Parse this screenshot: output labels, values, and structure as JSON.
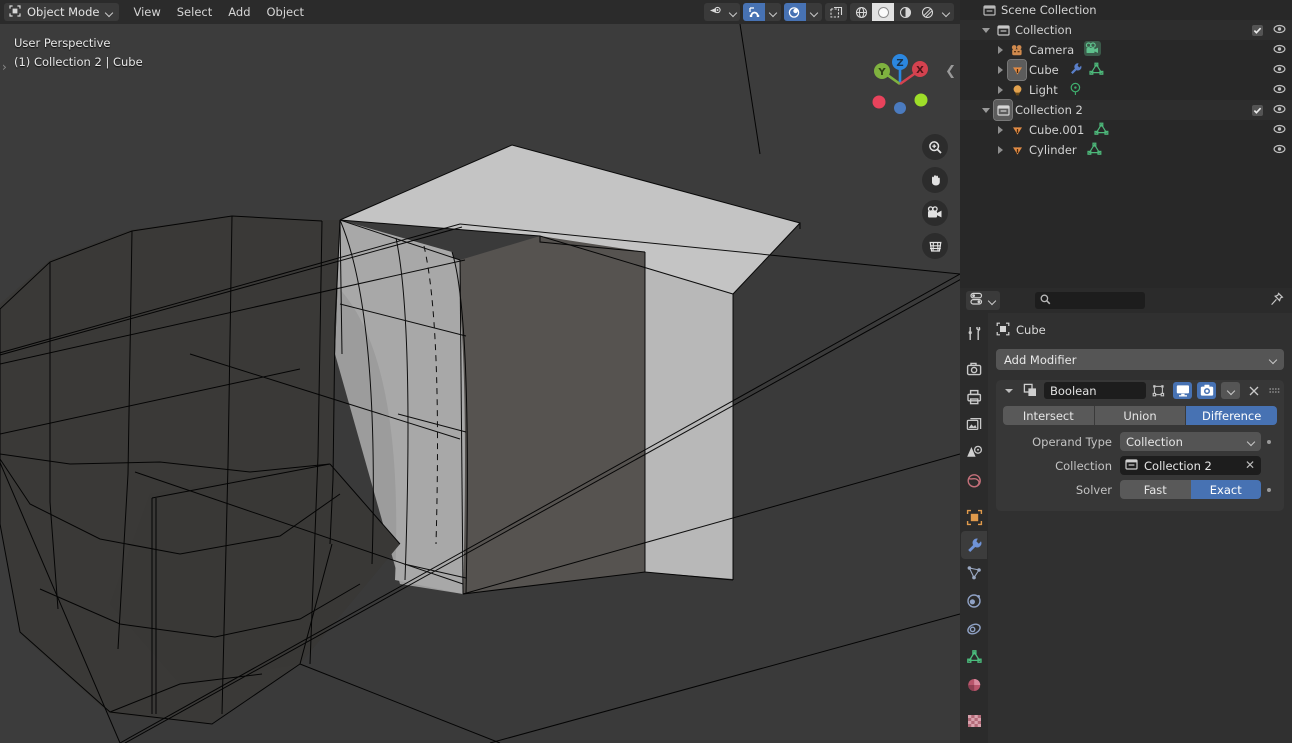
{
  "viewport_header": {
    "mode": "Object Mode",
    "mode_icon": "object-mode-icon",
    "menus": [
      "View",
      "Select",
      "Add",
      "Object"
    ],
    "right_icons": [
      {
        "name": "visibility-icon",
        "state": "off"
      },
      {
        "name": "snap-magnet-icon",
        "state": "on"
      },
      {
        "name": "proportional-editing-icon",
        "state": "on"
      },
      {
        "name": "xray-toggle-icon",
        "state": "off"
      },
      {
        "name": "shading-wireframe-icon",
        "state": "off"
      },
      {
        "name": "shading-solid-icon",
        "state": "selected"
      },
      {
        "name": "shading-material-icon",
        "state": "off"
      },
      {
        "name": "shading-rendered-icon",
        "state": "off"
      }
    ]
  },
  "viewport": {
    "perspective_label": "User Perspective",
    "scene_label": "(1) Collection 2 | Cube",
    "background_color": "#3c3c3c",
    "gizmo": {
      "axes": [
        {
          "label": "Z",
          "color": "#2b87e0"
        },
        {
          "label": "Y",
          "color": "#7fb23f"
        },
        {
          "label": "X",
          "color": "#d4424f"
        }
      ],
      "negative_dots": [
        "#e8435c",
        "#4b7bbf",
        "#9ede29"
      ]
    },
    "tools": [
      "zoom-icon",
      "pan-hand-icon",
      "camera-view-icon",
      "toggle-ortho-grid-icon"
    ]
  },
  "outliner": {
    "rows": [
      {
        "label": "Scene Collection",
        "icon": "scene-collection-icon",
        "indent": 0,
        "disclosure": "none",
        "checkbox": false,
        "eye": false,
        "selected": false,
        "extras": []
      },
      {
        "label": "Collection",
        "icon": "collection-icon",
        "indent": 1,
        "disclosure": "open",
        "checkbox": true,
        "eye": true,
        "selected": false,
        "extras": []
      },
      {
        "label": "Camera",
        "icon": "camera-object-icon",
        "indent": 2,
        "disclosure": "closed",
        "checkbox": false,
        "eye": true,
        "selected": false,
        "extras": [
          "camera-data-icon"
        ]
      },
      {
        "label": "Cube",
        "icon": "mesh-object-icon",
        "indent": 2,
        "disclosure": "closed",
        "checkbox": false,
        "eye": true,
        "selected": true,
        "extras": [
          "modifier-wrench-icon",
          "mesh-data-icon"
        ]
      },
      {
        "label": "Light",
        "icon": "light-object-icon",
        "indent": 2,
        "disclosure": "closed",
        "checkbox": false,
        "eye": true,
        "selected": false,
        "extras": [
          "light-data-icon"
        ]
      },
      {
        "label": "Collection 2",
        "icon": "collection-icon",
        "indent": 1,
        "disclosure": "open",
        "checkbox": true,
        "eye": true,
        "selected": false,
        "extras": []
      },
      {
        "label": "Cube.001",
        "icon": "mesh-object-icon",
        "indent": 2,
        "disclosure": "closed",
        "checkbox": false,
        "eye": true,
        "selected": false,
        "extras": [
          "mesh-data-icon"
        ]
      },
      {
        "label": "Cylinder",
        "icon": "mesh-object-icon",
        "indent": 2,
        "disclosure": "closed",
        "checkbox": false,
        "eye": true,
        "selected": false,
        "extras": [
          "mesh-data-icon"
        ]
      }
    ]
  },
  "properties": {
    "search_placeholder": "",
    "editor_type_icon": "editor-type-icon",
    "pin_icon": "pin-icon",
    "tabs": [
      {
        "name": "tool-tab",
        "icon": "tool-screwdriver-wrench-icon",
        "active": false
      },
      {
        "name": "render-tab",
        "icon": "render-camera-icon",
        "active": false
      },
      {
        "name": "output-tab",
        "icon": "output-printer-icon",
        "active": false
      },
      {
        "name": "view-layer-tab",
        "icon": "view-layer-images-icon",
        "active": false
      },
      {
        "name": "scene-tab",
        "icon": "scene-cone-icon",
        "active": false
      },
      {
        "name": "world-tab",
        "icon": "world-globe-icon",
        "active": false
      },
      {
        "name": "object-tab",
        "icon": "object-square-icon",
        "active": false
      },
      {
        "name": "modifier-tab",
        "icon": "modifier-wrench-icon",
        "active": true
      },
      {
        "name": "particles-tab",
        "icon": "particles-icon",
        "active": false
      },
      {
        "name": "physics-tab",
        "icon": "physics-orbit-icon",
        "active": false
      },
      {
        "name": "constraints-tab",
        "icon": "object-constraints-icon",
        "active": false
      },
      {
        "name": "data-tab",
        "icon": "mesh-data-triangle-icon",
        "active": false
      },
      {
        "name": "material-tab",
        "icon": "material-sphere-icon",
        "active": false
      },
      {
        "name": "texture-tab",
        "icon": "texture-checker-icon",
        "active": false
      }
    ],
    "breadcrumb": {
      "icon": "object-square-icon",
      "label": "Cube"
    },
    "add_modifier_label": "Add Modifier",
    "modifier": {
      "type_icon": "boolean-modifier-icon",
      "name": "Boolean",
      "header_toggles": [
        {
          "name": "edit-mode-display-toggle",
          "icon": "edit-mode-icon",
          "on": false
        },
        {
          "name": "realtime-display-toggle",
          "icon": "monitor-icon",
          "on": true
        },
        {
          "name": "render-display-toggle",
          "icon": "camera-icon",
          "on": true
        },
        {
          "name": "extras-dropdown",
          "icon": "chevron-down-icon",
          "on": false
        },
        {
          "name": "delete-modifier-button",
          "icon": "close-x-icon",
          "on": false
        },
        {
          "name": "drag-handle",
          "icon": "drag-dots-icon",
          "on": false
        }
      ],
      "operation": {
        "options": [
          "Intersect",
          "Union",
          "Difference"
        ],
        "selected": "Difference"
      },
      "fields": [
        {
          "label": "Operand Type",
          "type": "dropdown",
          "value": "Collection",
          "animate_dot": true
        },
        {
          "label": "Collection",
          "type": "id-field",
          "value": "Collection 2",
          "icon": "collection-icon",
          "clearable": true,
          "animate_dot": false
        },
        {
          "label": "Solver",
          "type": "segmented",
          "options": [
            "Fast",
            "Exact"
          ],
          "selected": "Exact",
          "animate_dot": true
        }
      ]
    }
  },
  "colors": {
    "accent_blue": "#4772b3",
    "panel_bg": "#303030",
    "header_bg": "#2b2b2b",
    "outliner_bg": "#282828",
    "viewport_bg": "#3c3c3c",
    "object_orange": "#e08a45",
    "mesh_green": "#44b36b"
  }
}
